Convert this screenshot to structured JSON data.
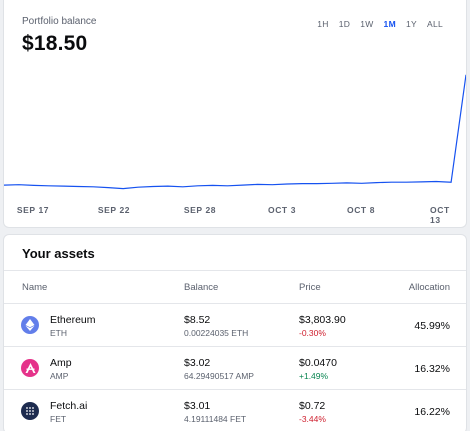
{
  "balance": {
    "label": "Portfolio balance",
    "value": "$18.50",
    "ranges": [
      "1H",
      "1D",
      "1W",
      "1M",
      "1Y",
      "ALL"
    ],
    "active_range": "1M"
  },
  "chart_data": {
    "type": "line",
    "x_tick_labels": [
      "SEP 17",
      "SEP 22",
      "SEP 28",
      "OCT 3",
      "OCT 8",
      "OCT 13"
    ],
    "values": [
      2.1,
      2.15,
      2.05,
      2.0,
      1.95,
      1.9,
      1.85,
      1.75,
      1.6,
      1.8,
      1.9,
      1.95,
      1.85,
      2.0,
      2.05,
      2.0,
      2.1,
      2.2,
      2.15,
      2.25,
      2.3,
      2.3,
      2.35,
      2.4,
      2.35,
      2.45,
      2.5,
      2.5,
      2.55,
      2.6,
      2.5,
      17.6
    ],
    "color": "#1652f0"
  },
  "assets": {
    "title": "Your assets",
    "columns": [
      "Name",
      "Balance",
      "Price",
      "Allocation"
    ],
    "rows": [
      {
        "name": "Ethereum",
        "symbol": "ETH",
        "balance": "$8.52",
        "amount": "0.00224035 ETH",
        "price": "$3,803.90",
        "change": "-0.30%",
        "allocation": "45.99%",
        "icon": "ethereum-icon",
        "icon_color": "#627eea",
        "change_color": "#cf202f"
      },
      {
        "name": "Amp",
        "symbol": "AMP",
        "balance": "$3.02",
        "amount": "64.29490517 AMP",
        "price": "$0.0470",
        "change": "+1.49%",
        "allocation": "16.32%",
        "icon": "amp-icon",
        "icon_color": "#e5338a",
        "change_color": "#098551"
      },
      {
        "name": "Fetch.ai",
        "symbol": "FET",
        "balance": "$3.01",
        "amount": "4.19111484 FET",
        "price": "$0.72",
        "change": "-3.44%",
        "allocation": "16.22%",
        "icon": "fetch-ai-icon",
        "icon_color": "#1d2b4f",
        "change_color": "#cf202f"
      }
    ]
  }
}
